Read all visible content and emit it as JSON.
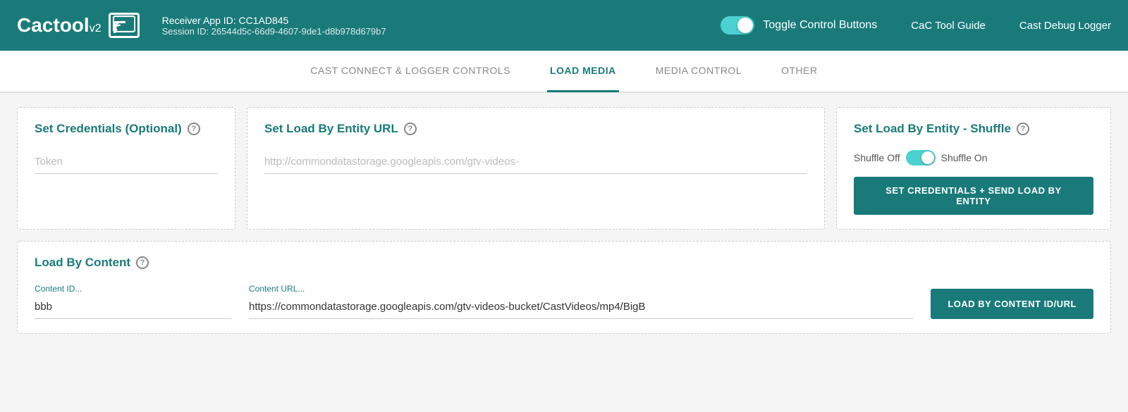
{
  "header": {
    "logo_text": "Cactool",
    "logo_version": "v2",
    "app_id_label": "Receiver App ID: CC1AD845",
    "session_id_label": "Session ID: 26544d5c-66d9-4607-9de1-d8b978d679b7",
    "toggle_label": "Toggle Control Buttons",
    "nav_guide": "CaC Tool Guide",
    "nav_logger": "Cast Debug Logger"
  },
  "tabs": [
    {
      "label": "CAST CONNECT & LOGGER CONTROLS",
      "active": false
    },
    {
      "label": "LOAD MEDIA",
      "active": true
    },
    {
      "label": "MEDIA CONTROL",
      "active": false
    },
    {
      "label": "OTHER",
      "active": false
    }
  ],
  "cards": {
    "credentials": {
      "title": "Set Credentials (Optional)",
      "token_placeholder": "Token"
    },
    "entity_url": {
      "title": "Set Load By Entity URL",
      "url_placeholder": "http://commondatastorage.googleapis.com/gtv-videos-"
    },
    "shuffle": {
      "title": "Set Load By Entity - Shuffle",
      "shuffle_off": "Shuffle Off",
      "shuffle_on": "Shuffle On",
      "button_label": "SET CREDENTIALS + SEND LOAD BY ENTITY"
    }
  },
  "load_content": {
    "title": "Load By Content",
    "content_id_label": "Content ID...",
    "content_id_value": "bbb",
    "content_url_label": "Content URL...",
    "content_url_value": "https://commondatastorage.googleapis.com/gtv-videos-bucket/CastVideos/mp4/BigB",
    "button_label": "LOAD BY CONTENT ID/URL"
  },
  "icons": {
    "help": "?",
    "cast_wifi": "wifi"
  },
  "colors": {
    "teal": "#1a7a7a",
    "teal_light": "#4dd0d0"
  }
}
